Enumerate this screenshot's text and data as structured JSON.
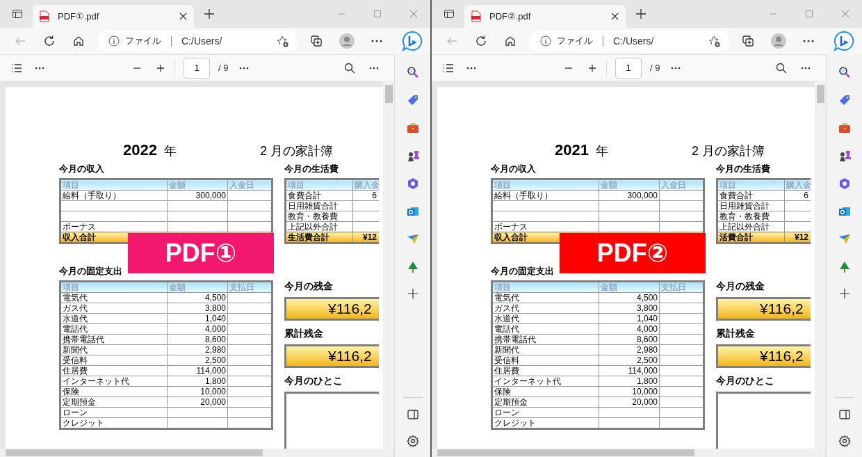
{
  "windows": [
    {
      "tab_title": "PDF①.pdf",
      "address_label": "ファイル",
      "address": "C:/Users/",
      "page_number": "1",
      "page_total": "/ 9",
      "document": {
        "year": "2022",
        "year_unit": "年",
        "month_title": "2 月の家計簿",
        "income": {
          "title": "今月の収入",
          "columns": [
            "項目",
            "金額",
            "入金日"
          ],
          "rows": [
            {
              "item": "給料（手取り）",
              "amount": "300,000"
            },
            {},
            {},
            {
              "item": "ボーナス"
            }
          ],
          "total": {
            "item": "収入合計"
          }
        },
        "living": {
          "title": "今月の生活費",
          "columns": [
            "項目",
            "購入金"
          ],
          "rows": [
            {
              "item": "食費合計",
              "amount": "6"
            },
            {
              "item": "日用雑貨合計"
            },
            {
              "item": "教育・教養費"
            },
            {
              "item": "上記以外合計"
            }
          ],
          "total": {
            "item": "生活費合計",
            "amount": "¥12"
          }
        },
        "fixed": {
          "title": "今月の固定支出",
          "columns": [
            "項目",
            "金額",
            "支払日"
          ],
          "rows": [
            {
              "item": "電気代",
              "amount": "4,500"
            },
            {
              "item": "ガス代",
              "amount": "3,800"
            },
            {
              "item": "水道代",
              "amount": "1,040"
            },
            {
              "item": "電話代",
              "amount": "4,000"
            },
            {
              "item": "携帯電話代",
              "amount": "8,600"
            },
            {
              "item": "新聞代",
              "amount": "2,980"
            },
            {
              "item": "受信料",
              "amount": "2,500"
            },
            {
              "item": "住居費",
              "amount": "114,000"
            },
            {
              "item": "インターネット代",
              "amount": "1,800"
            },
            {
              "item": "保険",
              "amount": "10,000"
            },
            {
              "item": "定期預金",
              "amount": "20,000"
            },
            {
              "item": "ローン"
            },
            {
              "item": "クレジット"
            }
          ]
        },
        "balance_title": "今月の残金",
        "balance": "¥116,2",
        "cumulative_title": "累計残金",
        "cumulative": "¥116,2",
        "comment_title": "今月のひとこ"
      },
      "overlay": {
        "label": "PDF①",
        "color": "#f2176f"
      }
    },
    {
      "tab_title": "PDF②.pdf",
      "address_label": "ファイル",
      "address": "C:/Users/",
      "page_number": "1",
      "page_total": "/ 9",
      "document": {
        "year": "2021",
        "year_unit": "年",
        "month_title": "2 月の家計簿",
        "income": {
          "title": "今月の収入",
          "columns": [
            "項目",
            "金額",
            "入金日"
          ],
          "rows": [
            {
              "item": "給料（手取り）",
              "amount": "300,000"
            },
            {},
            {},
            {
              "item": "ボーナス"
            }
          ],
          "total": {
            "item": "収入合計"
          }
        },
        "living": {
          "title": "今月の生活費",
          "columns": [
            "項目",
            "購入金"
          ],
          "rows": [
            {
              "item": "食費合計",
              "amount": "6"
            },
            {
              "item": "日用雑貨合計"
            },
            {
              "item": "教育・教養費"
            },
            {
              "item": "上記以外合計"
            }
          ],
          "total": {
            "item": "活費合計",
            "amount": "¥12"
          }
        },
        "fixed": {
          "title": "今月の固定支出",
          "columns": [
            "項目",
            "金額",
            "支払日"
          ],
          "rows": [
            {
              "item": "電気代",
              "amount": "4,500"
            },
            {
              "item": "ガス代",
              "amount": "3,800"
            },
            {
              "item": "水道代",
              "amount": "1,040"
            },
            {
              "item": "電話代",
              "amount": "4,000"
            },
            {
              "item": "携帯電話代",
              "amount": "8,600"
            },
            {
              "item": "新聞代",
              "amount": "2,980"
            },
            {
              "item": "受信料",
              "amount": "2,500"
            },
            {
              "item": "住居費",
              "amount": "114,000"
            },
            {
              "item": "インターネット代",
              "amount": "1,800"
            },
            {
              "item": "保険",
              "amount": "10,000"
            },
            {
              "item": "定期預金",
              "amount": "20,000"
            },
            {
              "item": "ローン"
            },
            {
              "item": "クレジット"
            }
          ]
        },
        "balance_title": "今月の残金",
        "balance": "¥116,2",
        "cumulative_title": "累計残金",
        "cumulative": "¥116,2",
        "comment_title": "今月のひとこ"
      },
      "overlay": {
        "label": "PDF②",
        "color": "#fe0000"
      }
    }
  ]
}
